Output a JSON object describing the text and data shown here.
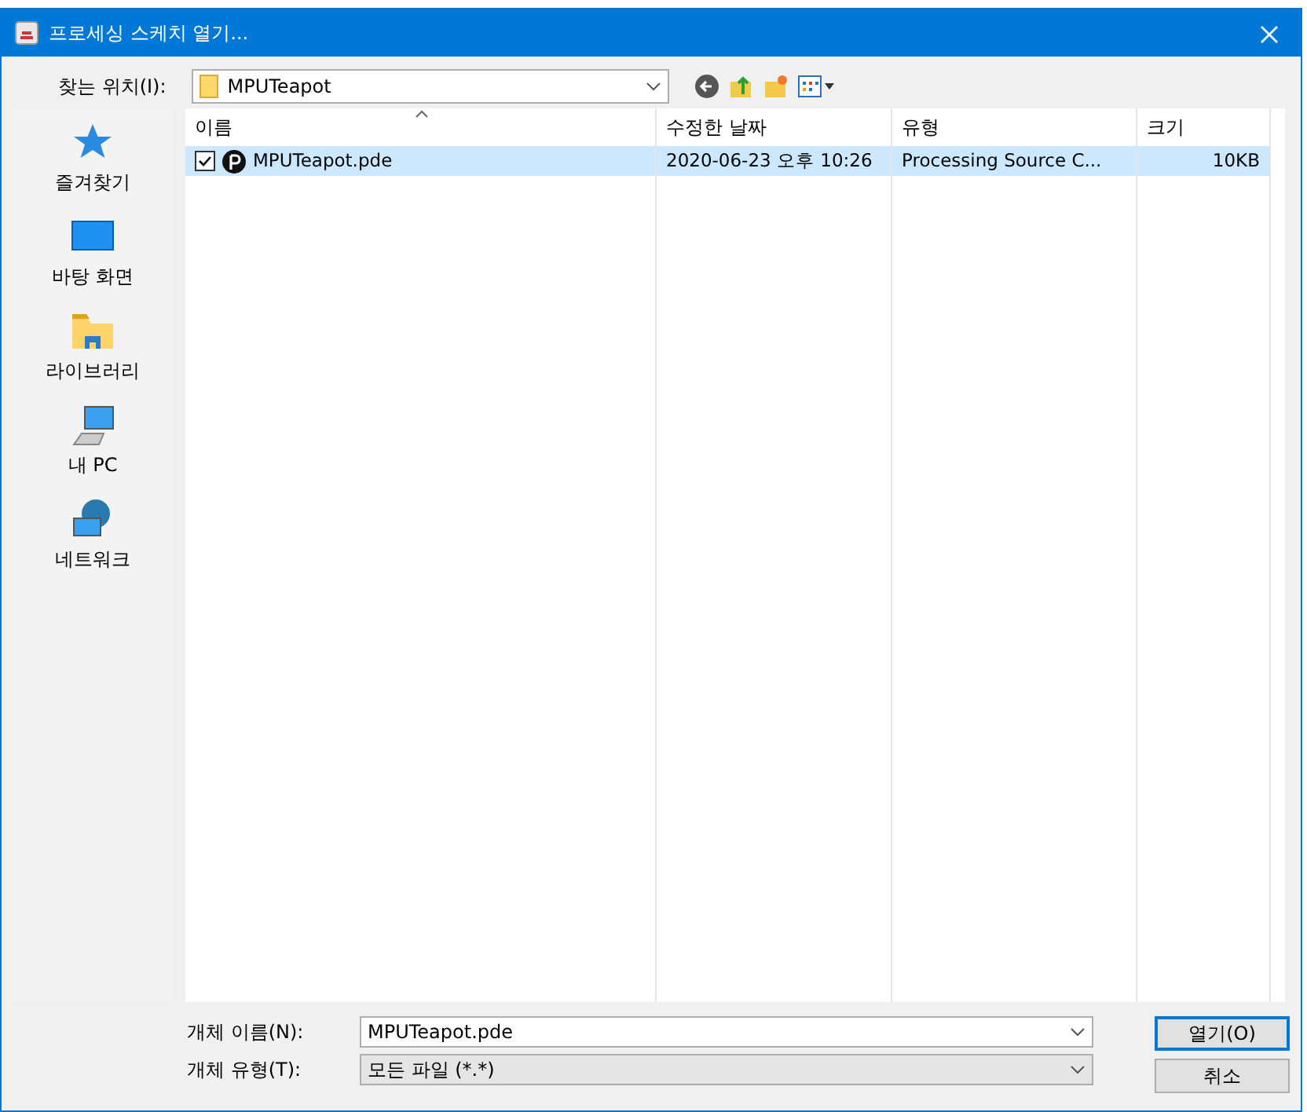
{
  "window": {
    "title": "프로세싱 스케치 열기..."
  },
  "location": {
    "label": "찾는 위치(I):",
    "value": "MPUTeapot"
  },
  "sidebar": {
    "items": [
      {
        "kind": "favorites",
        "label": "즐겨찾기"
      },
      {
        "kind": "desktop",
        "label": "바탕 화면"
      },
      {
        "kind": "library",
        "label": "라이브러리"
      },
      {
        "kind": "pc",
        "label": "내 PC"
      },
      {
        "kind": "network",
        "label": "네트워크"
      }
    ]
  },
  "table": {
    "columns": [
      "이름",
      "수정한 날짜",
      "유형",
      "크기"
    ],
    "rows": [
      {
        "selected": true,
        "checked": true,
        "cells": [
          "MPUTeapot.pde",
          "2020-06-23 오후 10:26",
          "Processing Source C...",
          "10KB"
        ]
      }
    ]
  },
  "file_name": {
    "label": "개체 이름(N):",
    "value": "MPUTeapot.pde"
  },
  "file_type": {
    "label": "개체 유형(T):",
    "value": "모든 파일 (*.*)"
  },
  "buttons": [
    "열기(O)",
    "취소"
  ]
}
